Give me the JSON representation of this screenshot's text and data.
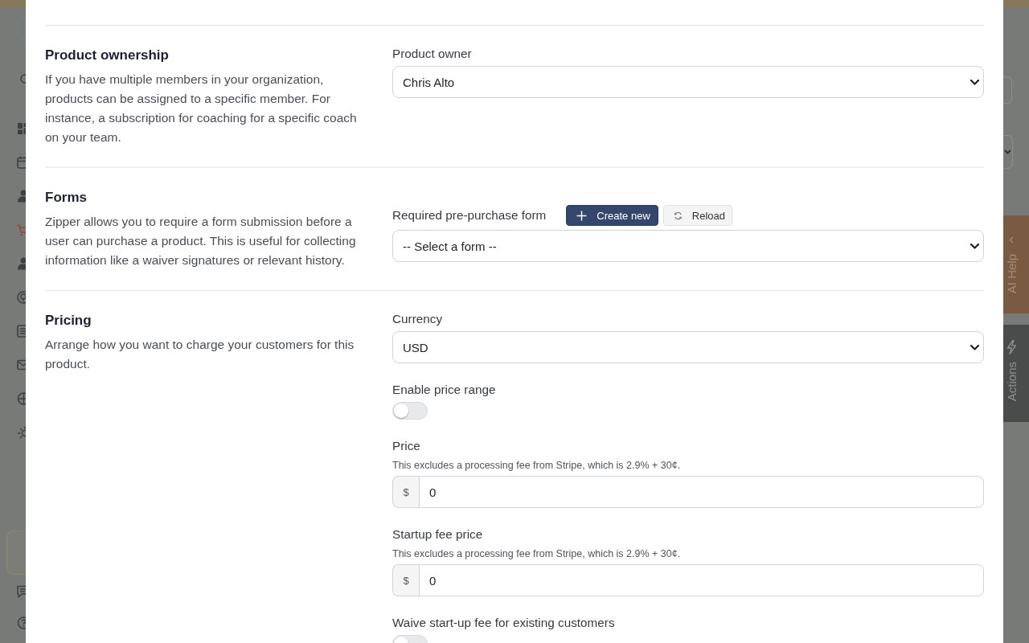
{
  "background": {
    "side_tabs": [
      {
        "kind": "assistant",
        "label": "AI Help"
      },
      {
        "kind": "actions",
        "label": "Actions"
      }
    ]
  },
  "dialog": {
    "sections": [
      {
        "title": "Product ownership",
        "description": "If you have multiple members in your organization, products can be assigned to a specific member. For instance, a subscription for coaching for a specific coach on your team.",
        "fields": [
          {
            "kind": "select",
            "label": "Product owner",
            "value": "Chris Alto"
          }
        ]
      },
      {
        "title": "Forms",
        "description": "Zipper allows you to require a form submission before a user can purchase a product. This is useful for collecting information like a waiver signatures or relevant history.",
        "fields": [
          {
            "kind": "select",
            "label": "Required pre-purchase form",
            "value": "-- Select a form --",
            "actions": [
              {
                "kind": "primary",
                "label": "Create new"
              },
              {
                "kind": "secondary",
                "label": "Reload"
              }
            ]
          }
        ]
      },
      {
        "title": "Pricing",
        "description": "Arrange how you want to charge your customers for this product.",
        "fields": [
          {
            "kind": "select",
            "label": "Currency",
            "value": "USD"
          },
          {
            "kind": "toggle",
            "label": "Enable price range",
            "on": false
          },
          {
            "kind": "money",
            "label": "Price",
            "hint": "This excludes a processing fee from Stripe, which is 2.9% + 30¢.",
            "prefix": "$",
            "value": "0"
          },
          {
            "kind": "money",
            "label": "Startup fee price",
            "hint": "This excludes a processing fee from Stripe, which is 2.9% + 30¢.",
            "prefix": "$",
            "value": "0"
          },
          {
            "kind": "toggle",
            "label": "Waive start-up fee for existing customers",
            "on": false
          }
        ]
      }
    ]
  }
}
